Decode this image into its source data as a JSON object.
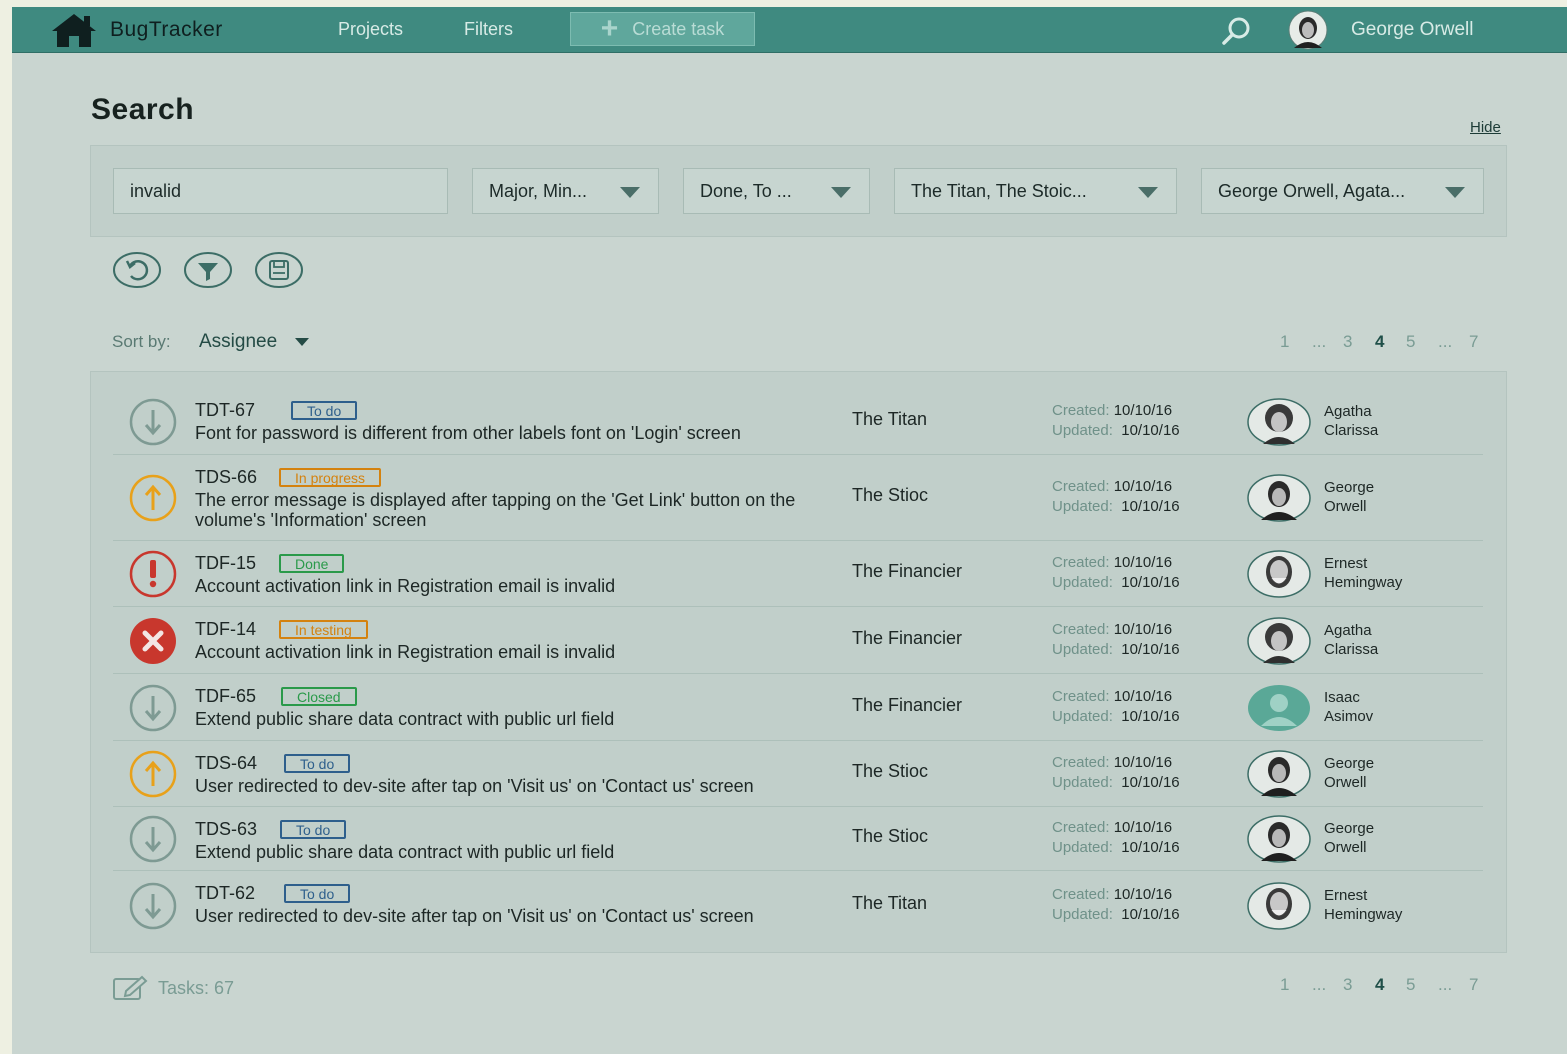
{
  "header": {
    "brand": "BugTracker",
    "nav": [
      "Projects",
      "Filters"
    ],
    "create_label": "Create task",
    "user_name": "George Orwell"
  },
  "search": {
    "title": "Search",
    "hide_label": "Hide",
    "query": "invalid",
    "priority": "Major, Min...",
    "status": "Done, To ...",
    "projects": "The Titan, The Stoic...",
    "assignees": "George Orwell, Agata..."
  },
  "sort": {
    "label": "Sort by:",
    "value": "Assignee"
  },
  "pagination": [
    "1",
    "...",
    "3",
    "4",
    "5",
    "...",
    "7"
  ],
  "pagination_current": "4",
  "labels": {
    "created": "Created:",
    "updated": "Updated:"
  },
  "colors": {
    "todo": "#2e5f8c",
    "in_progress": "#d4820f",
    "done": "#2a9a4a",
    "in_testing": "#d4820f",
    "closed": "#2a9a4a",
    "priority_low": "#7e9a93",
    "priority_major": "#e8a11a",
    "priority_critical": "#c8372d"
  },
  "tasks": [
    {
      "id": "TDT-67",
      "status": "To do",
      "status_kind": "todo",
      "priority_icon": "arrow-down-icon",
      "summary": "Font for password is different from other labels font on 'Login' screen",
      "project": "The Titan",
      "created": "10/10/16",
      "updated": "10/10/16",
      "assignee": [
        "Agatha",
        "Clarissa"
      ],
      "avatar": "avatar-agatha"
    },
    {
      "id": "TDS-66",
      "status": "In progress",
      "status_kind": "in_progress",
      "priority_icon": "arrow-up-icon",
      "summary": "The error message is displayed after tapping on the 'Get Link' button on the volume's 'Information' screen",
      "project": "The Stioc",
      "created": "10/10/16",
      "updated": "10/10/16",
      "assignee": [
        "George",
        "Orwell"
      ],
      "avatar": "avatar-george"
    },
    {
      "id": "TDF-15",
      "status": "Done",
      "status_kind": "done",
      "priority_icon": "exclamation-icon",
      "summary": "Account activation link in Registration email is invalid",
      "project": "The Financier",
      "created": "10/10/16",
      "updated": "10/10/16",
      "assignee": [
        "Ernest",
        "Hemingway"
      ],
      "avatar": "avatar-ernest"
    },
    {
      "id": "TDF-14",
      "status": "In testing",
      "status_kind": "in_testing",
      "priority_icon": "blocker-icon",
      "summary": "Account activation link in Registration email is invalid",
      "project": "The Financier",
      "created": "10/10/16",
      "updated": "10/10/16",
      "assignee": [
        "Agatha",
        "Clarissa"
      ],
      "avatar": "avatar-agatha"
    },
    {
      "id": "TDF-65",
      "status": "Closed",
      "status_kind": "closed",
      "priority_icon": "arrow-down-icon",
      "summary": "Extend public share data contract with public url field",
      "project": "The Financier",
      "created": "10/10/16",
      "updated": "10/10/16",
      "assignee": [
        "Isaac",
        "Asimov"
      ],
      "avatar": "avatar-placeholder"
    },
    {
      "id": "TDS-64",
      "status": "To do",
      "status_kind": "todo",
      "priority_icon": "arrow-up-icon",
      "summary": "User redirected to dev-site after tap on 'Visit us' on 'Contact us' screen",
      "project": "The Stioc",
      "created": "10/10/16",
      "updated": "10/10/16",
      "assignee": [
        "George",
        "Orwell"
      ],
      "avatar": "avatar-george"
    },
    {
      "id": "TDS-63",
      "status": "To do",
      "status_kind": "todo",
      "priority_icon": "arrow-down-icon",
      "summary": "Extend public share data contract with public url field",
      "project": "The Stioc",
      "created": "10/10/16",
      "updated": "10/10/16",
      "assignee": [
        "George",
        "Orwell"
      ],
      "avatar": "avatar-george"
    },
    {
      "id": "TDT-62",
      "status": "To do",
      "status_kind": "todo",
      "priority_icon": "arrow-down-icon",
      "summary": "User redirected to dev-site after tap on 'Visit us' on 'Contact us' screen",
      "project": "The Titan",
      "created": "10/10/16",
      "updated": "10/10/16",
      "assignee": [
        "Ernest",
        "Hemingway"
      ],
      "avatar": "avatar-ernest"
    }
  ],
  "footer": {
    "tasks_label": "Tasks: 67"
  }
}
